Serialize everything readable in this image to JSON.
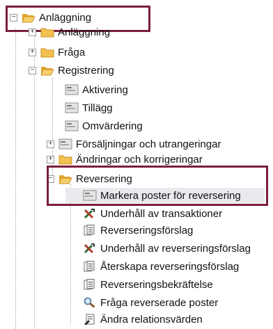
{
  "tree": {
    "root": {
      "label": "Anläggning",
      "expander": "−"
    },
    "items": [
      {
        "label": "Anläggning",
        "expander": "+",
        "icon": "folder-icon"
      },
      {
        "label": "Fråga",
        "expander": "+",
        "icon": "folder-icon"
      },
      {
        "label": "Registrering",
        "expander": "−",
        "icon": "folder-open-icon"
      },
      {
        "label": "Aktivering",
        "icon": "form-icon"
      },
      {
        "label": "Tillägg",
        "icon": "form-icon"
      },
      {
        "label": "Omvärdering",
        "icon": "form-icon"
      },
      {
        "label": "Försäljningar och utrangeringar",
        "expander": "+",
        "icon": "form-icon"
      },
      {
        "label": "Ändringar och korrigeringar",
        "expander": "+",
        "icon": "folder-icon"
      },
      {
        "label": "Reversering",
        "expander": "−",
        "icon": "folder-open-icon"
      },
      {
        "label": "Markera poster för reversering",
        "icon": "form-icon"
      },
      {
        "label": "Underhåll av transaktioner",
        "icon": "tools-icon"
      },
      {
        "label": "Reverseringsförslag",
        "icon": "report-icon"
      },
      {
        "label": "Underhåll av reverseringsförslag",
        "icon": "tools-icon"
      },
      {
        "label": "Återskapa reverseringsförslag",
        "icon": "report-icon"
      },
      {
        "label": "Reverseringsbekräftelse",
        "icon": "report-icon"
      },
      {
        "label": "Fråga reverserade poster",
        "icon": "magnifier-icon"
      },
      {
        "label": "Ändra relationsvärden",
        "icon": "edit-document-icon"
      }
    ]
  },
  "colors": {
    "highlight": "#7b1e3b",
    "folder": "#f2c14e"
  }
}
